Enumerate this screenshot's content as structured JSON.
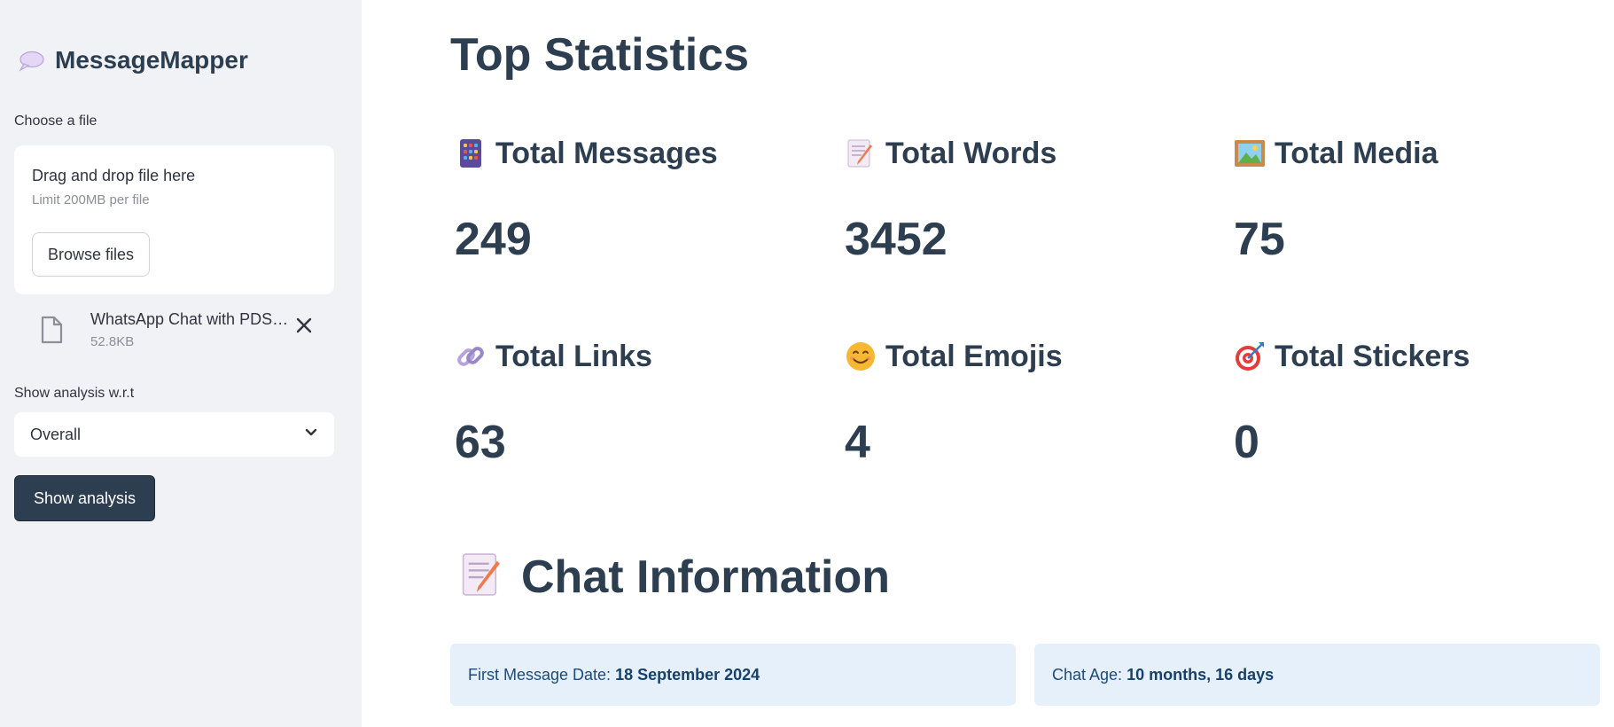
{
  "sidebar": {
    "brand": "MessageMapper",
    "file_label": "Choose a file",
    "dropzone": {
      "title": "Drag and drop file here",
      "limit": "Limit 200MB per file",
      "browse_label": "Browse files"
    },
    "uploaded_file": {
      "name": "WhatsApp Chat with PDS…",
      "size": "52.8KB"
    },
    "analysis_label": "Show analysis w.r.t",
    "analysis_select": {
      "value": "Overall"
    },
    "show_button": "Show analysis"
  },
  "main": {
    "title": "Top Statistics",
    "stats": [
      {
        "label": "Total Messages",
        "value": "249",
        "icon": "abacus-icon"
      },
      {
        "label": "Total Words",
        "value": "3452",
        "icon": "memo-icon"
      },
      {
        "label": "Total Media",
        "value": "75",
        "icon": "framed-picture-icon"
      },
      {
        "label": "Total Links",
        "value": "63",
        "icon": "link-icon"
      },
      {
        "label": "Total Emojis",
        "value": "4",
        "icon": "smiling-face-icon"
      },
      {
        "label": "Total Stickers",
        "value": "0",
        "icon": "bullseye-icon"
      }
    ],
    "chat_info": {
      "title": "Chat Information",
      "first_label": "First Message Date: ",
      "first_value": "18 September 2024",
      "age_label": "Chat Age: ",
      "age_value": "10 months, 16 days"
    }
  },
  "colors": {
    "sidebar_bg": "#f0f2f6",
    "text": "#2c3e50",
    "primary_button": "#2c3e50",
    "info_bg": "#e6f0fa"
  }
}
